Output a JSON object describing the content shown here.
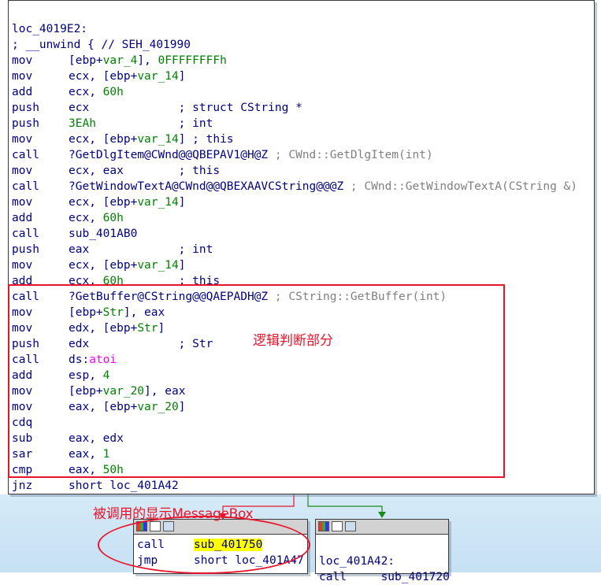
{
  "main_node": {
    "label": "loc_4019E2:",
    "seh_comment": "; __unwind { // SEH_401990",
    "lines": [
      {
        "mn": "mov",
        "ops": [
          {
            "t": "[ebp+"
          },
          {
            "t": "var_4",
            "c": "var"
          },
          {
            "t": "], "
          },
          {
            "t": "0FFFFFFFFh",
            "c": "num"
          }
        ]
      },
      {
        "mn": "mov",
        "ops": [
          {
            "t": "ecx, [ebp+"
          },
          {
            "t": "var_14",
            "c": "var"
          },
          {
            "t": "]"
          }
        ]
      },
      {
        "mn": "add",
        "ops": [
          {
            "t": "ecx, "
          },
          {
            "t": "60h",
            "c": "num"
          }
        ]
      },
      {
        "mn": "push",
        "ops": [
          {
            "t": "ecx             ; struct CString *"
          }
        ]
      },
      {
        "mn": "push",
        "ops": [
          {
            "t": "3EAh",
            "c": "num"
          },
          {
            "t": "            ; int"
          }
        ]
      },
      {
        "mn": "mov",
        "ops": [
          {
            "t": "ecx, [ebp+"
          },
          {
            "t": "var_14",
            "c": "var"
          },
          {
            "t": "] ; this"
          }
        ]
      },
      {
        "mn": "call",
        "ops": [
          {
            "t": "?GetDlgItem@CWnd@@QBEPAV1@H@Z"
          },
          {
            "t": " ; CWnd::GetDlgItem(int)",
            "c": "gray"
          }
        ]
      },
      {
        "mn": "mov",
        "ops": [
          {
            "t": "ecx, eax        ; this"
          }
        ]
      },
      {
        "mn": "call",
        "ops": [
          {
            "t": "?GetWindowTextA@CWnd@@QBEXAAVCString@@@Z"
          },
          {
            "t": " ; CWnd::GetWindowTextA(CString &)",
            "c": "gray"
          }
        ]
      },
      {
        "mn": "mov",
        "ops": [
          {
            "t": "ecx, [ebp+"
          },
          {
            "t": "var_14",
            "c": "var"
          },
          {
            "t": "]"
          }
        ]
      },
      {
        "mn": "add",
        "ops": [
          {
            "t": "ecx, "
          },
          {
            "t": "60h",
            "c": "num"
          }
        ]
      },
      {
        "mn": "call",
        "ops": [
          {
            "t": "sub_401AB0"
          }
        ]
      },
      {
        "mn": "push",
        "ops": [
          {
            "t": "eax             ; int"
          }
        ]
      },
      {
        "mn": "mov",
        "ops": [
          {
            "t": "ecx, [ebp+"
          },
          {
            "t": "var_14",
            "c": "var"
          },
          {
            "t": "]"
          }
        ]
      },
      {
        "mn": "add",
        "ops": [
          {
            "t": "ecx, "
          },
          {
            "t": "60h",
            "c": "num"
          },
          {
            "t": "        ; this"
          }
        ]
      },
      {
        "mn": "call",
        "ops": [
          {
            "t": "?GetBuffer@CString@@QAEPADH@Z"
          },
          {
            "t": " ; CString::GetBuffer(int)",
            "c": "gray"
          }
        ]
      },
      {
        "mn": "mov",
        "ops": [
          {
            "t": "[ebp+"
          },
          {
            "t": "Str",
            "c": "var"
          },
          {
            "t": "], eax"
          }
        ]
      },
      {
        "mn": "mov",
        "ops": [
          {
            "t": "edx, [ebp+"
          },
          {
            "t": "Str",
            "c": "var"
          },
          {
            "t": "]"
          }
        ]
      },
      {
        "mn": "push",
        "ops": [
          {
            "t": "edx             ; Str"
          }
        ]
      },
      {
        "mn": "call",
        "ops": [
          {
            "t": "ds:"
          },
          {
            "t": "atoi",
            "c": "imp"
          }
        ]
      },
      {
        "mn": "add",
        "ops": [
          {
            "t": "esp, "
          },
          {
            "t": "4",
            "c": "num"
          }
        ]
      },
      {
        "mn": "mov",
        "ops": [
          {
            "t": "[ebp+"
          },
          {
            "t": "var_20",
            "c": "var"
          },
          {
            "t": "], eax"
          }
        ]
      },
      {
        "mn": "mov",
        "ops": [
          {
            "t": "eax, [ebp+"
          },
          {
            "t": "var_20",
            "c": "var"
          },
          {
            "t": "]"
          }
        ]
      },
      {
        "mn": "cdq",
        "ops": []
      },
      {
        "mn": "sub",
        "ops": [
          {
            "t": "eax, edx"
          }
        ]
      },
      {
        "mn": "sar",
        "ops": [
          {
            "t": "eax, "
          },
          {
            "t": "1",
            "c": "num"
          }
        ]
      },
      {
        "mn": "cmp",
        "ops": [
          {
            "t": "eax, "
          },
          {
            "t": "50h",
            "c": "num"
          }
        ]
      },
      {
        "mn": "jnz",
        "ops": [
          {
            "t": "short loc_401A42"
          }
        ]
      }
    ]
  },
  "annotations": {
    "logic_label": "逻辑判断部分",
    "msgbox_label": "被调用的显示MessageBox"
  },
  "left_node": {
    "lines": [
      {
        "mn": "call",
        "ops": [
          {
            "t": "sub_401750",
            "c": "hl"
          }
        ]
      },
      {
        "mn": "jmp",
        "ops": [
          {
            "t": "short loc_401A47"
          }
        ]
      }
    ]
  },
  "right_node": {
    "label": "loc_401A42:",
    "partial_line": "call     sub_401720"
  },
  "colors": {
    "annotation": "#e8152a",
    "edge_false": "#e8152a",
    "edge_true": "#1a8a1a",
    "graph_bg": "#d6eaf7",
    "highlight": "#ffff00"
  },
  "icons": [
    "graph-overview-icon",
    "edit-node-icon",
    "node-color-icon"
  ]
}
